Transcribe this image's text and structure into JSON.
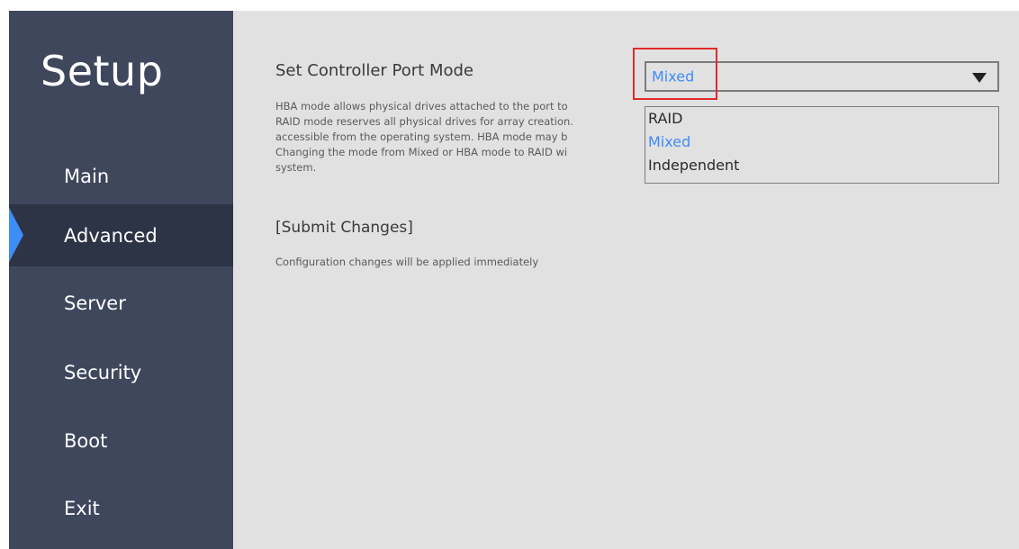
{
  "sidebar": {
    "title": "Setup",
    "items": [
      {
        "label": "Main"
      },
      {
        "label": "Advanced"
      },
      {
        "label": "Server"
      },
      {
        "label": "Security"
      },
      {
        "label": "Boot"
      },
      {
        "label": "Exit"
      }
    ],
    "selected": "Advanced"
  },
  "main": {
    "setting_title": "Set Controller Port Mode",
    "help_text": "HBA mode allows physical drives attached to the port to\nRAID mode reserves all physical drives for array creation.\naccessible from the operating system. HBA mode may b\nChanging the mode from Mixed or HBA mode to RAID wi\nsystem.",
    "submit_label": "[Submit Changes]",
    "submit_note": "Configuration changes will be applied immediately"
  },
  "dropdown": {
    "selected_value": "Mixed",
    "options": [
      {
        "label": "RAID"
      },
      {
        "label": "Mixed"
      },
      {
        "label": "Independent"
      }
    ],
    "arrow_icon": "triangle-down-icon"
  },
  "colors": {
    "sidebar_bg": "#3e475c",
    "sidebar_selected_bg": "#2d3446",
    "accent": "#3e8cf7",
    "content_bg": "#e1e1e1",
    "highlight": "#e02a2a"
  }
}
